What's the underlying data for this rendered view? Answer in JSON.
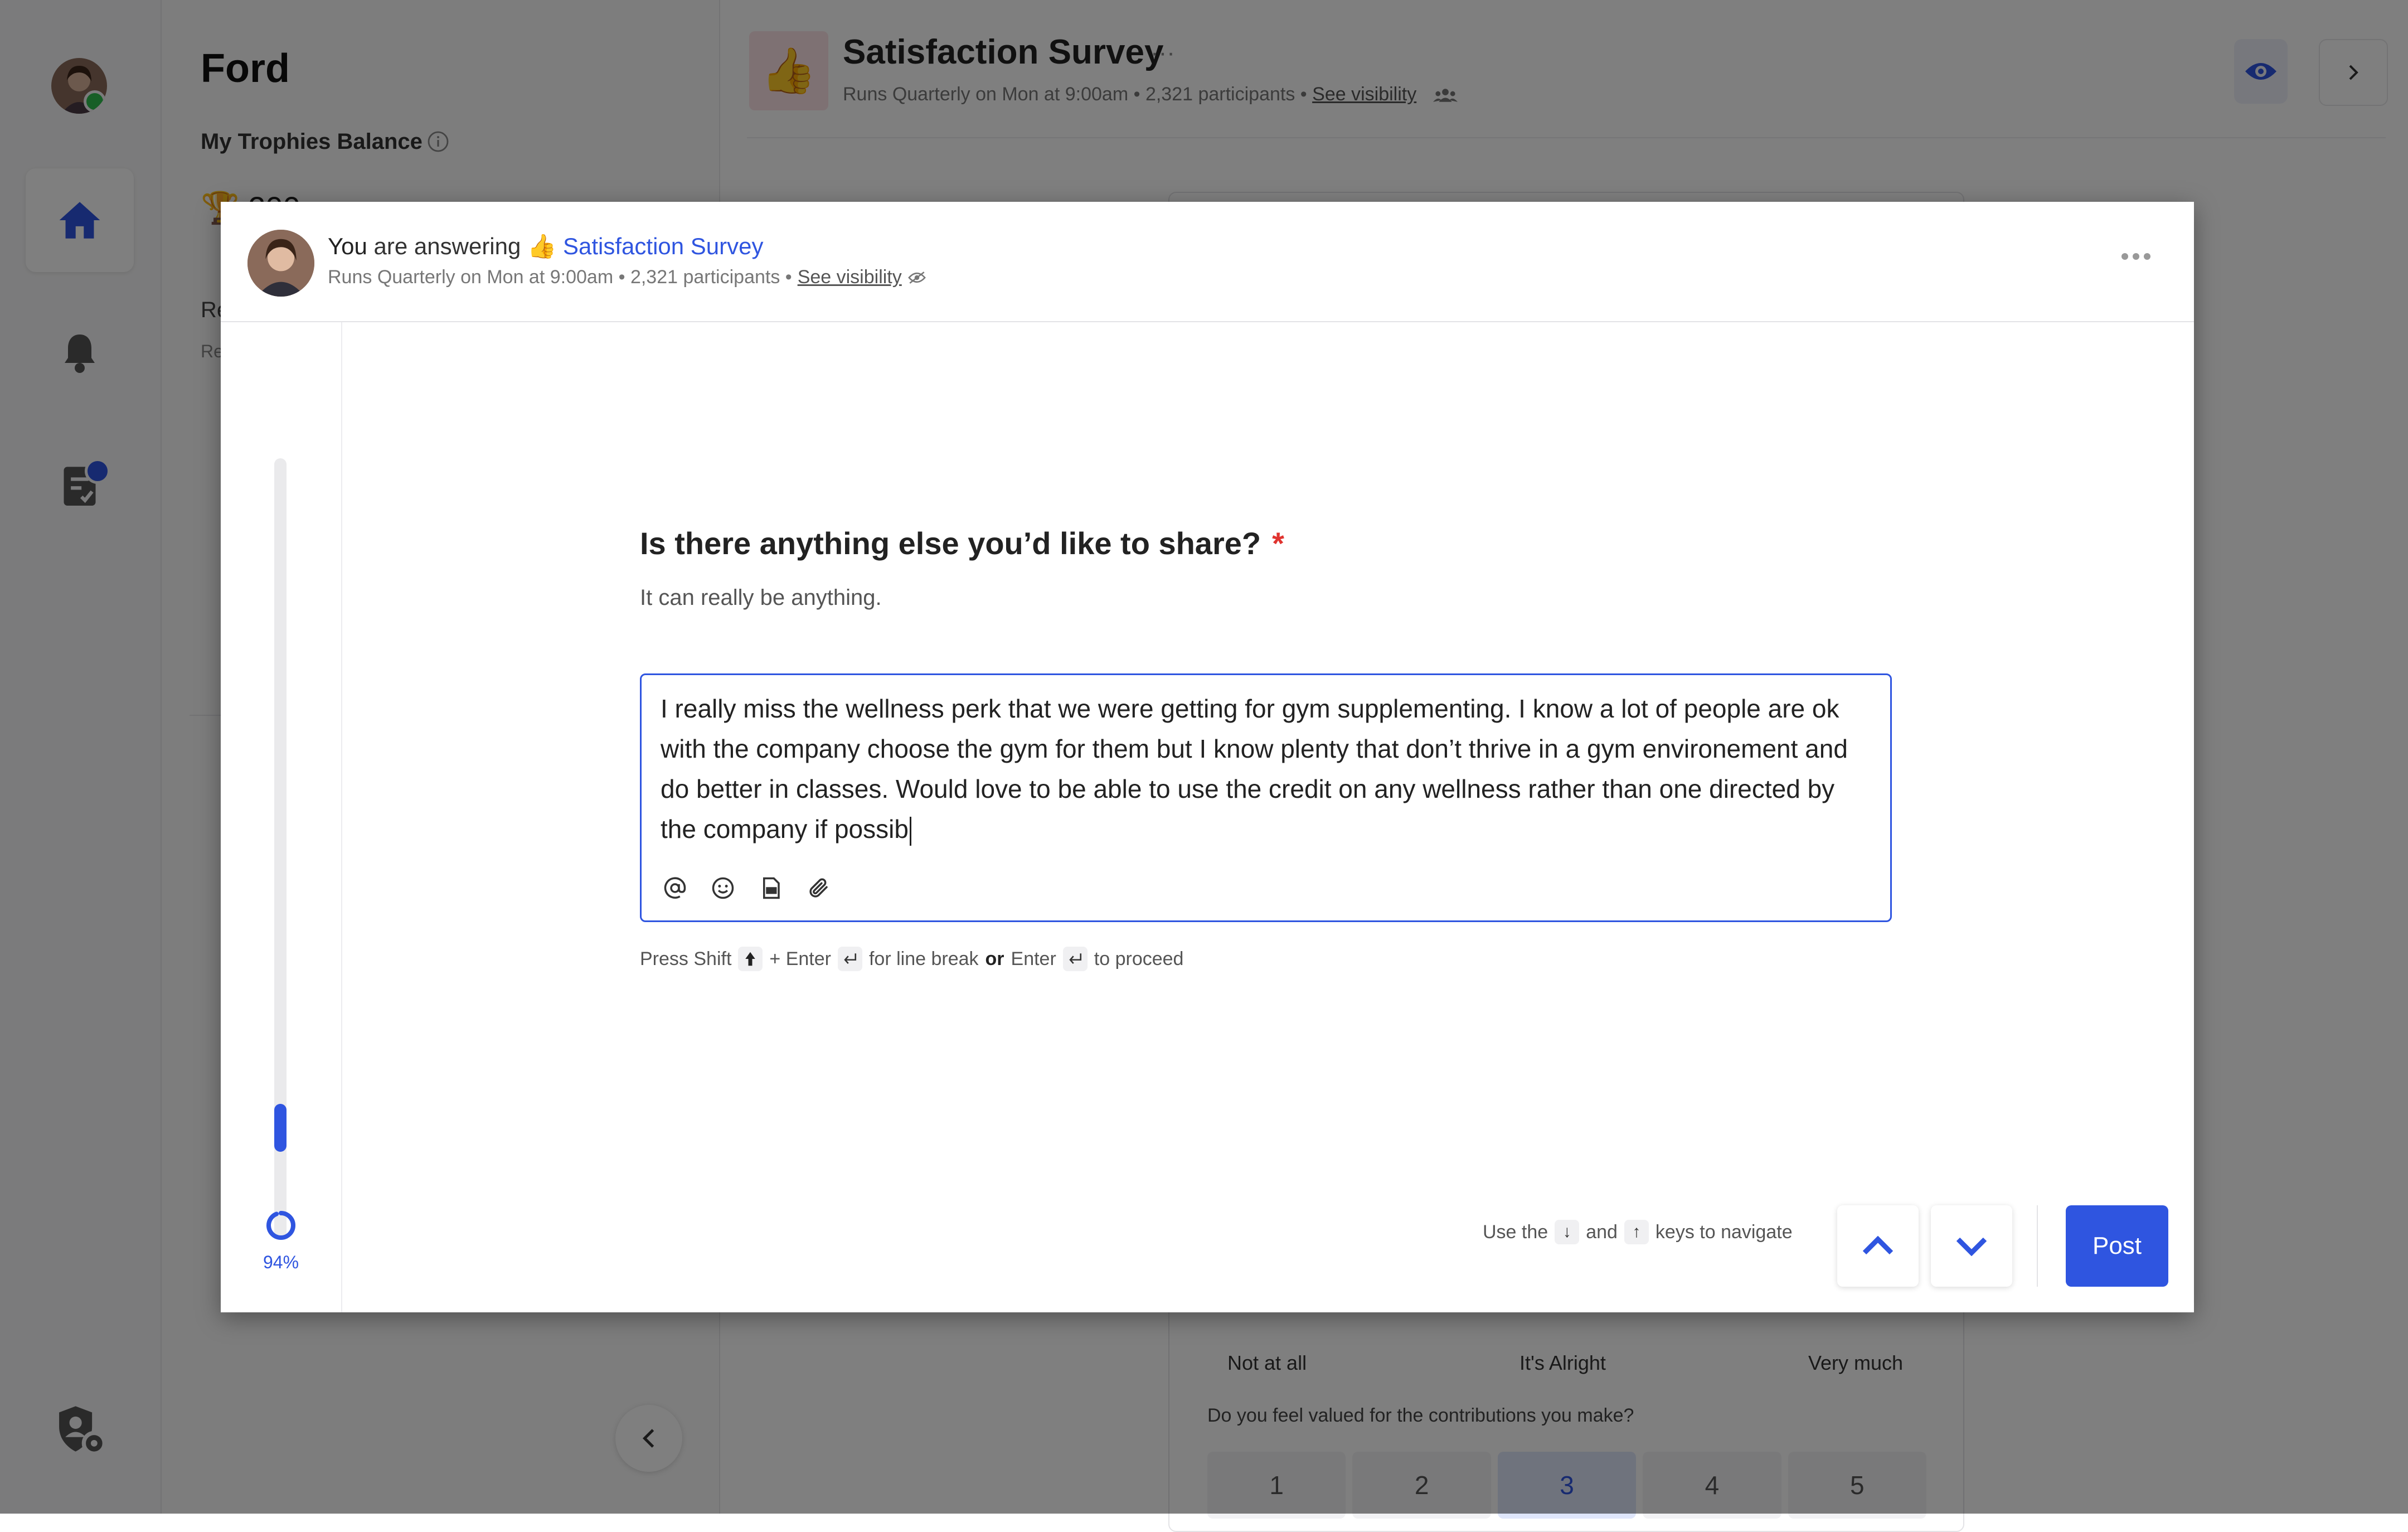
{
  "sidebar": {
    "org_name": "Ford",
    "trophies_label": "My Trophies Balance",
    "trophies_value": "🏆 200",
    "snippet_title": "Re",
    "snippet_sub": "Re"
  },
  "background": {
    "survey_icon": "👍",
    "survey_title": "Satisfaction Survey",
    "survey_meta": "Runs Quarterly on Mon at 9:00am • 2,321 participants • ",
    "see_visibility": "See visibility",
    "scale_low": "Not at all",
    "scale_mid": "It's Alright",
    "scale_high": "Very much",
    "question": "Do you feel valued for the contributions you make?",
    "options": [
      "1",
      "2",
      "3",
      "4",
      "5"
    ],
    "selected_option": "3"
  },
  "modal": {
    "answering_you": "You",
    "answering_prefix": " are answering ",
    "survey_emoji": "👍",
    "survey_name": "Satisfaction Survey",
    "meta": "Runs Quarterly on Mon at 9:00am • 2,321 participants •",
    "see_visibility": "See visibility",
    "progress_pct": "94%",
    "progress_value": 0.94,
    "question": {
      "title": "Is there anything else you’d like to share?",
      "required_mark": "*",
      "subtitle": "It can really be anything.",
      "answer": "I really miss the wellness perk that we were getting for gym supplementing. I know a lot of people are ok with the company choose the gym for them but I know plenty that don’t thrive in a gym environement and do better in classes. Would love to be able to use the credit on any wellness rather than one directed by the company if possib"
    },
    "hint": {
      "press": "Press Shift",
      "plus_enter": "+ Enter",
      "line_break": "for line break",
      "or": "or",
      "enter": "Enter",
      "proceed": "to proceed"
    },
    "nav": {
      "use_the": "Use the",
      "and": "and",
      "keys": "keys to navigate",
      "down_key": "↓",
      "up_key": "↑"
    },
    "post_label": "Post"
  },
  "colors": {
    "accent": "#2f55e0",
    "required": "#e0332f",
    "online": "#2fbf4f"
  }
}
